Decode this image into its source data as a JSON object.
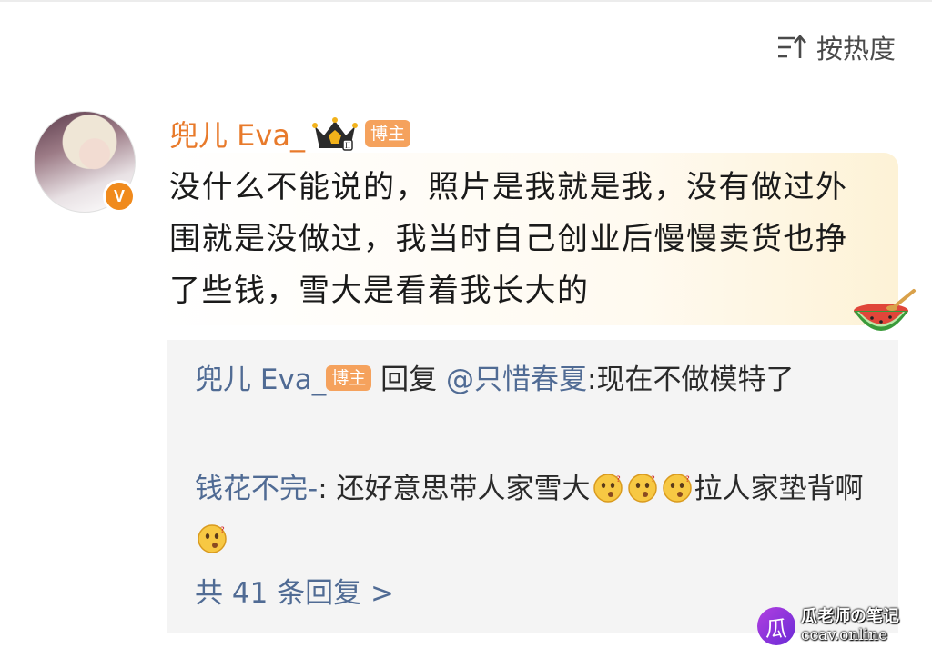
{
  "sort": {
    "label": "按热度",
    "icon": "sort-icon"
  },
  "comment": {
    "author": "兜儿 Eva_",
    "crown_icon": "crown-icon",
    "author_tag": "博主",
    "verified_badge": "V",
    "text": "没什么不能说的，照片是我就是我，没有做过外围就是没做过，我当时自己创业后慢慢卖货也挣了些钱，雪大是看着我长大的",
    "sticker_icon": "watermelon-icon"
  },
  "replies": [
    {
      "author": "兜儿 Eva_",
      "tag": "博主",
      "reply_word": " 回复 ",
      "mention": "@只惜春夏",
      "text": ":现在不做模特了"
    },
    {
      "author": "钱花不完-",
      "text_a": ": 还好意思带人家雪大",
      "text_b": "拉人家垫背啊",
      "emoji_icon": "thinking-face-emoji"
    }
  ],
  "more_replies": "共 41 条回复 >",
  "watermark": {
    "title": "瓜老师の笔记",
    "url": "ccav.online",
    "logo_glyph": "瓜"
  },
  "colors": {
    "author_orange": "#e87a2b",
    "link_blue": "#506b94",
    "tag_orange": "#f5a25d",
    "reply_bg": "#f4f4f4"
  }
}
